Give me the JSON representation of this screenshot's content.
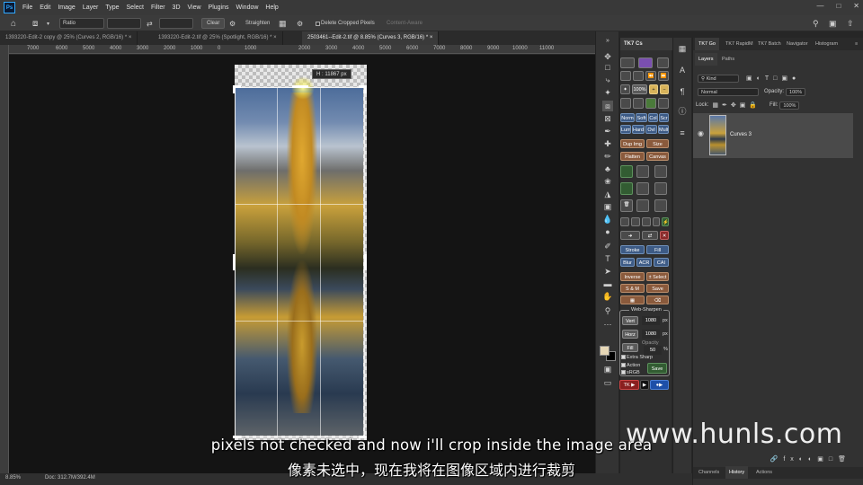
{
  "app": {
    "logo_text": "Ps",
    "menu": [
      "File",
      "Edit",
      "Image",
      "Layer",
      "Type",
      "Select",
      "Filter",
      "3D",
      "View",
      "Plugins",
      "Window",
      "Help"
    ]
  },
  "options_bar": {
    "ratio_label": "Ratio",
    "clear_label": "Clear",
    "straighten_label": "Straighten",
    "delete_cropped_label": "Delete Cropped Pixels",
    "content_aware_label": "Content-Aware"
  },
  "document_tabs": [
    {
      "label": "1393220-Edit-2 copy @ 25% (Curves 2, RGB/16) *",
      "active": false
    },
    {
      "label": "1393220-Edit-2.tif @ 25% (Spotlight, RGB/16) *",
      "active": false
    },
    {
      "label": "2503461--Edit-2.tif @ 8.85% (Curves 3, RGB/16) *",
      "active": true
    }
  ],
  "ruler_ticks": [
    "7000",
    "6000",
    "5000",
    "4000",
    "3000",
    "2000",
    "1000",
    "0",
    "1000",
    "2000",
    "3000",
    "4000",
    "5000",
    "6000",
    "7000",
    "8000",
    "9000",
    "10000",
    "11000"
  ],
  "canvas": {
    "tooltip": "H : 11867 px"
  },
  "tk_panel": {
    "title": "TK7 Cs",
    "buttons": {
      "norm": "Norm",
      "soft": "Soft",
      "col": "Col",
      "scr": "Scr",
      "lum": "Lum",
      "hard": "Hard",
      "ovl": "Ovl",
      "mult": "Mult",
      "dup_img": "Dup Img",
      "size": "Size",
      "flatten": "Flatten",
      "canvas": "Canvas",
      "stroke": "Stroke",
      "fill": "Fill",
      "blur": "Blur",
      "acr": "ACR",
      "cai": "CAI",
      "inverse": "Inverse",
      "select": "± Select",
      "s_and_m": "S & M",
      "save": "Save",
      "zoom_pct": "100%"
    },
    "web_sharpen": {
      "title": "Web-Sharpen",
      "vert_label": "Vert",
      "vert_value": "1080",
      "horz_label": "Horz",
      "horz_value": "1080",
      "px_unit": "px",
      "fill_label": "Fill",
      "opacity_label": "Opacity",
      "opacity_value": "50",
      "pct": "%",
      "extra_sharp": "Extra Sharp",
      "action": "Action",
      "srgb": "sRGB",
      "save": "Save"
    },
    "tk_label": "TK"
  },
  "right_panel": {
    "top_tabs": [
      "TK7 Go",
      "TK7 RapidM",
      "TK7 Batch",
      "Navigator",
      "Histogram"
    ],
    "sub_tabs": [
      "Layers",
      "Paths"
    ],
    "kind_label": "Kind",
    "blend_mode": "Normal",
    "opacity_label": "Opacity:",
    "opacity_value": "100%",
    "lock_label": "Lock:",
    "fill_label": "Fill:",
    "fill_value": "100%",
    "layer_name": "Curves 3",
    "bottom_tabs": [
      "Channels",
      "History",
      "Actions"
    ]
  },
  "status": {
    "zoom": "8.85%",
    "doc": "Doc: 312.7M/392.4M"
  },
  "overlay": {
    "subtitle_en": "pixels not checked and now i'll crop inside the image area",
    "subtitle_zh": "像素未选中，现在我将在图像区域内进行裁剪",
    "watermark": "www.hunls.com"
  }
}
